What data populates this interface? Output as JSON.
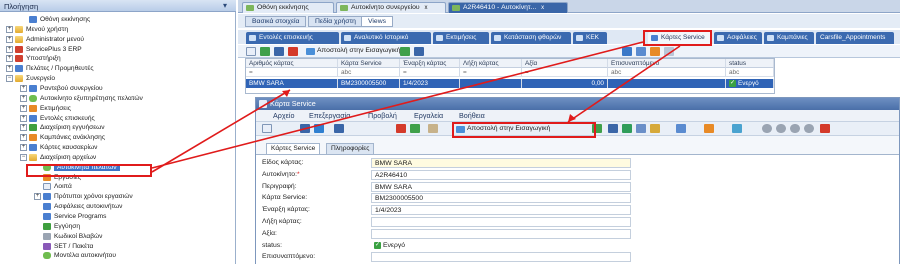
{
  "nav": {
    "title": "Πλοήγηση",
    "items": [
      {
        "label": "Οθόνη εκκίνησης",
        "icon": "home-icon",
        "level": 1,
        "expander": ""
      },
      {
        "label": "Μενού χρήστη",
        "icon": "folder-icon",
        "level": 0,
        "expander": "+"
      },
      {
        "label": "Administrator μενού",
        "icon": "folder-icon",
        "level": 0,
        "expander": "+"
      },
      {
        "label": "ServicePlus 3 ERP",
        "icon": "erp-icon",
        "level": 0,
        "expander": "+"
      },
      {
        "label": "Υποστήριξη",
        "icon": "support-icon",
        "level": 0,
        "expander": "+"
      },
      {
        "label": "Πελάτες / Προμηθευτές",
        "icon": "customers-icon",
        "level": 0,
        "expander": "+"
      },
      {
        "label": "Συνεργείο",
        "icon": "folder-icon",
        "level": 0,
        "expander": "−"
      },
      {
        "label": "Ραντεβού συνεργείου",
        "icon": "calendar-icon",
        "level": 1,
        "expander": "+"
      },
      {
        "label": "Αυτοκίνητο εξυπηρέτησης πελατών",
        "icon": "car-icon",
        "level": 1,
        "expander": "+"
      },
      {
        "label": "Εκτιμήσεις",
        "icon": "estimate-icon",
        "level": 1,
        "expander": "+"
      },
      {
        "label": "Εντολές επισκευής",
        "icon": "repair-icon",
        "level": 1,
        "expander": "+"
      },
      {
        "label": "Διαχείριση εγγυήσεων",
        "icon": "warranty-icon",
        "level": 1,
        "expander": "+"
      },
      {
        "label": "Καμπάνιες ανάκλησης",
        "icon": "campaign-icon",
        "level": 1,
        "expander": "+"
      },
      {
        "label": "Κάρτες καυσαερίων",
        "icon": "card-icon",
        "level": 1,
        "expander": "+"
      },
      {
        "label": "Διαχείριση αρχείων",
        "icon": "folder-icon",
        "level": 1,
        "expander": "−"
      },
      {
        "label": "Αυτοκίνητα πελατών",
        "icon": "car-icon",
        "level": 2,
        "expander": "",
        "selected": true
      },
      {
        "label": "Εργασίες",
        "icon": "tasks-icon",
        "level": 2,
        "expander": ""
      },
      {
        "label": "Λοιπά",
        "icon": "misc-icon",
        "level": 2,
        "expander": ""
      },
      {
        "label": "Πρότυποι χρόνοι εργασιών",
        "icon": "time-icon",
        "level": 2,
        "expander": "+"
      },
      {
        "label": "Ασφάλειες αυτοκινήτων",
        "icon": "insurance-icon",
        "level": 2,
        "expander": ""
      },
      {
        "label": "Service Programs",
        "icon": "program-icon",
        "level": 2,
        "expander": ""
      },
      {
        "label": "Εγγύηση",
        "icon": "guarantee-icon",
        "level": 2,
        "expander": ""
      },
      {
        "label": "Κωδικοί Βλαβών",
        "icon": "fault-icon",
        "level": 2,
        "expander": ""
      },
      {
        "label": "SET / Πακέτα",
        "icon": "package-icon",
        "level": 2,
        "expander": ""
      },
      {
        "label": "Μοντέλα αυτοκινήτου",
        "icon": "model-icon",
        "level": 2,
        "expander": ""
      }
    ]
  },
  "top_tabs": [
    {
      "label": "Οθόνη εκκίνησης",
      "active": false,
      "close": ""
    },
    {
      "label": "Αυτοκίνητο συνεργείου",
      "active": false,
      "close": "x"
    },
    {
      "label": "A2R46410 - Αυτοκίνητ...",
      "active": true,
      "close": "x"
    }
  ],
  "sub_tabs": [
    {
      "label": "Βασικά στοιχεία",
      "active": false
    },
    {
      "label": "Πεδία χρήστη",
      "active": false
    },
    {
      "label": "Views",
      "active": true
    }
  ],
  "module_tabs": [
    {
      "label": "Εντολές επισκευής",
      "active": false
    },
    {
      "label": "Αναλυτικό Ιστορικό",
      "active": false
    },
    {
      "label": "Εκτιμήσεις",
      "active": false
    },
    {
      "label": "Κατάσταση φθορών",
      "active": false
    },
    {
      "label": "KEK",
      "active": false
    },
    {
      "label": "Κάρτες Service",
      "active": true
    },
    {
      "label": "Ασφάλειες",
      "active": false
    },
    {
      "label": "Καμπάνιες",
      "active": false
    },
    {
      "label": "Carsfile_Appointments",
      "active": false
    }
  ],
  "grid_toolbar": {
    "send_label": "Αποστολή στην Εισαγωγική"
  },
  "grid": {
    "columns": [
      "Αριθμός κάρτας",
      "Κάρτα Service",
      "Έναρξη κάρτας",
      "Λήξη κάρτας",
      "Αξία",
      "Επισυναπτόμενο",
      "status"
    ],
    "filter": [
      "=",
      "abc",
      "=",
      "=",
      "=",
      "abc",
      "abc"
    ],
    "row": [
      "BMW SARA",
      "BM2300005500",
      "1/4/2023",
      "",
      "0,00",
      "",
      "Ενεργό"
    ]
  },
  "dialog": {
    "title": "Κάρτα Service",
    "menu": [
      "Αρχείο",
      "Επεξεργασία",
      "Προβολή",
      "Εργαλεία",
      "Βοήθεια"
    ],
    "send_label": "Αποστολή στην Εισαγωγική",
    "tabs": [
      {
        "label": "Κάρτες Service",
        "active": true
      },
      {
        "label": "Πληροφορίες",
        "active": false
      }
    ],
    "fields": [
      {
        "label": "Είδος κάρτας:",
        "value": "BMW SARA",
        "required": false
      },
      {
        "label": "Αυτοκίνητο:",
        "value": "A2R46410",
        "required": true
      },
      {
        "label": "Περιγραφή:",
        "value": "BMW SARA",
        "required": false
      },
      {
        "label": "Κάρτα Service:",
        "value": "BM2300005500",
        "required": false
      },
      {
        "label": "Έναρξη κάρτας:",
        "value": "1/4/2023",
        "required": false
      },
      {
        "label": "Λήξη κάρτας:",
        "value": "",
        "required": false
      },
      {
        "label": "Αξία:",
        "value": "",
        "required": false
      },
      {
        "label": "status:",
        "value": "Ενεργό",
        "required": false
      },
      {
        "label": "Επισυναπτόμενο:",
        "value": "",
        "required": false
      }
    ]
  },
  "colors": {
    "accent": "#3b6ab0",
    "selection": "#2f63b6",
    "annotation": "#e01b1b"
  }
}
